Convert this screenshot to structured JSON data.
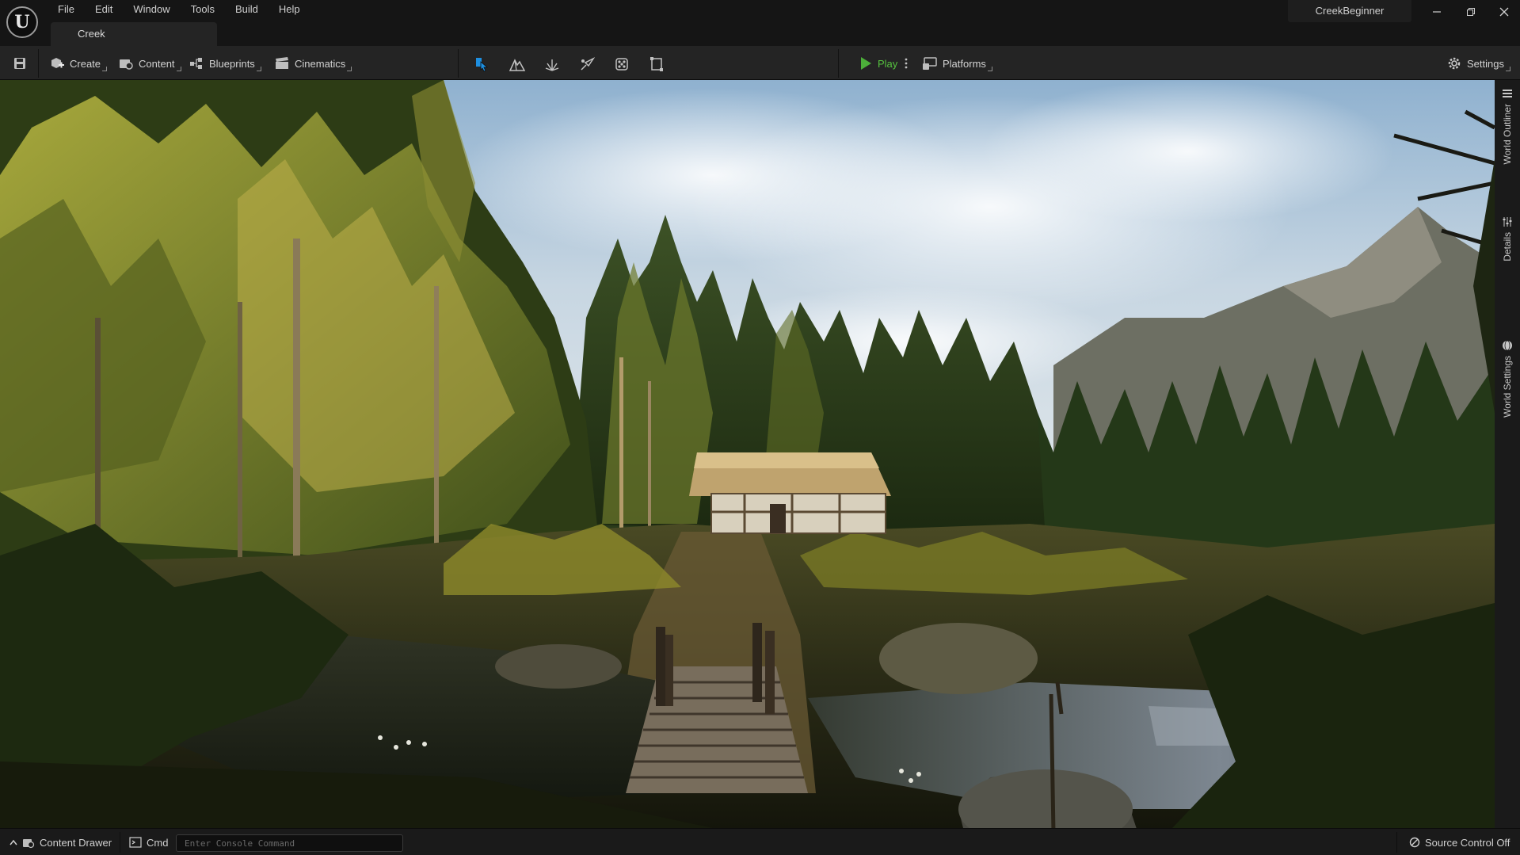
{
  "app": {
    "project_name": "CreekBeginner",
    "level_tab": "Creek"
  },
  "menu": [
    "File",
    "Edit",
    "Window",
    "Tools",
    "Build",
    "Help"
  ],
  "toolbar": {
    "save_icon": "save-icon",
    "create_label": "Create",
    "content_label": "Content",
    "blueprints_label": "Blueprints",
    "cinematics_label": "Cinematics",
    "modes": [
      "select-mode-icon",
      "landscape-mode-icon",
      "foliage-mode-icon",
      "mesh-paint-mode-icon",
      "fracture-mode-icon",
      "modeling-mode-icon"
    ],
    "play_label": "Play",
    "platforms_label": "Platforms",
    "settings_label": "Settings"
  },
  "side_tabs": {
    "outliner": "World Outliner",
    "details": "Details",
    "world_settings": "World Settings"
  },
  "statusbar": {
    "content_drawer_label": "Content Drawer",
    "cmd_label": "Cmd",
    "console_placeholder": "Enter Console Command",
    "source_control_label": "Source Control Off"
  },
  "colors": {
    "play_green": "#4caf3a",
    "select_mode_blue": "#1e8fe0",
    "chrome_dark": "#151515",
    "toolbar_bg": "#242424"
  }
}
